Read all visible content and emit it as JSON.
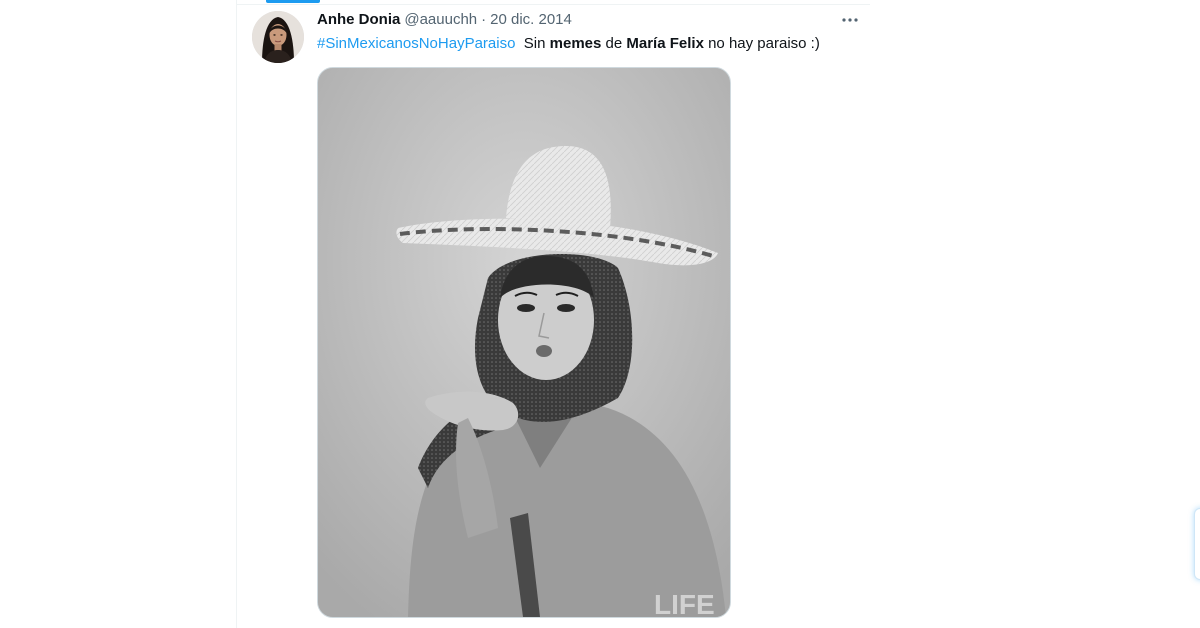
{
  "tweet": {
    "display_name": "Anhe Donia",
    "handle": "@aauuchh",
    "separator": "·",
    "date": "20 dic. 2014",
    "more_icon": "ellipsis-icon",
    "text": {
      "hashtag": "#SinMexicanosNoHayParaiso",
      "part1": "Sin ",
      "bold1": "memes",
      "part2": " de ",
      "bold2": "María Felix",
      "part3": " no hay paraiso :)"
    },
    "media_watermark": "LIFE"
  },
  "colors": {
    "accent": "#1d9bf0",
    "text_primary": "#0f1419",
    "text_secondary": "#536471"
  }
}
